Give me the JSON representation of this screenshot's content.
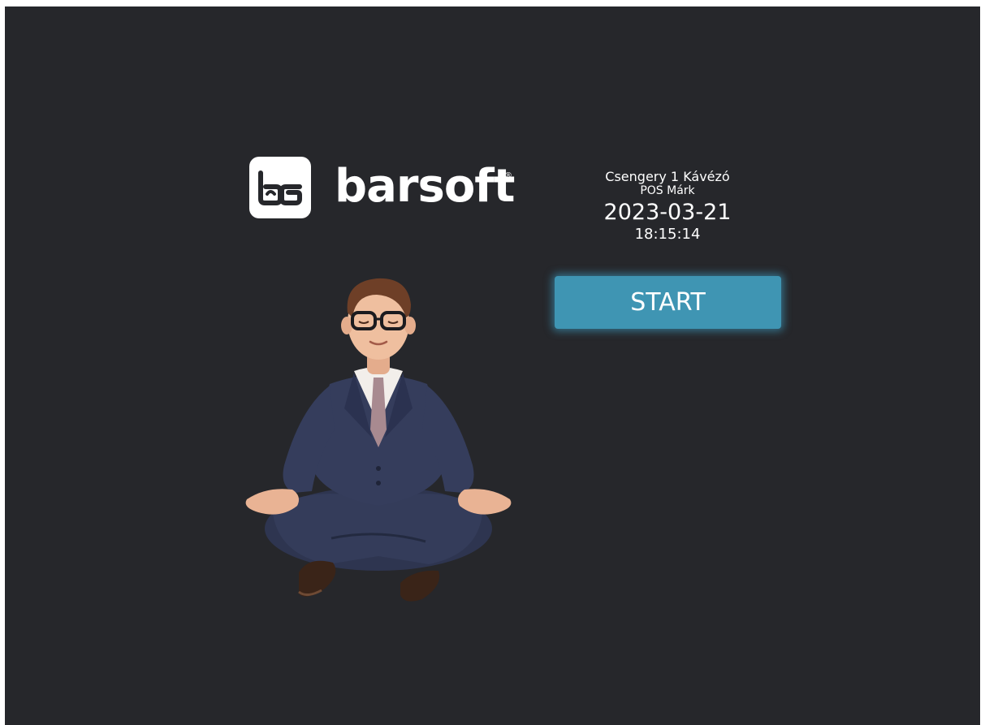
{
  "brand": {
    "name": "barsoft",
    "registered_mark": "®",
    "logo_icon": "barsoft-glasses-icon"
  },
  "info": {
    "venue": "Csengery 1 Kávézó",
    "pos_name": "POS Márk",
    "date": "2023-03-21",
    "time": "18:15:14"
  },
  "actions": {
    "start_label": "START"
  },
  "illustration": {
    "icon": "meditating-businessman-illustration"
  },
  "colors": {
    "background": "#26272b",
    "start_button": "#3f95b3",
    "text": "#ffffff"
  }
}
